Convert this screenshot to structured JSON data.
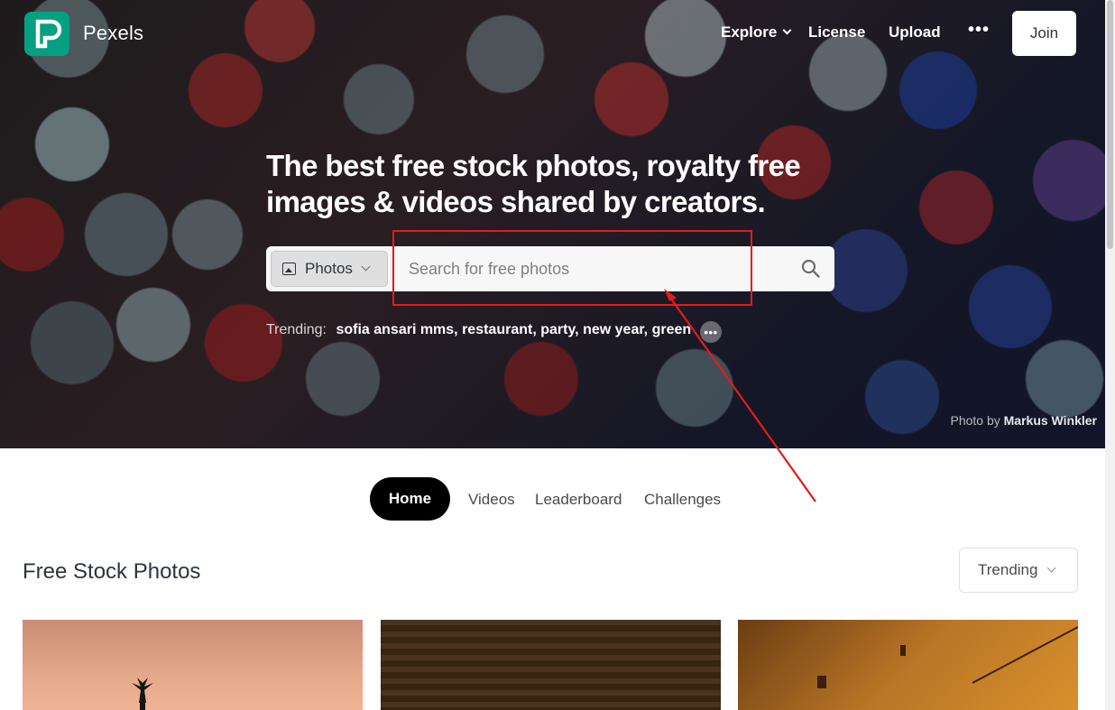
{
  "brand": {
    "name": "Pexels"
  },
  "nav": {
    "explore": "Explore",
    "license": "License",
    "upload": "Upload",
    "more": "•••",
    "join": "Join"
  },
  "hero": {
    "title": "The best free stock photos, royalty free images & videos shared by creators.",
    "credit_prefix": "Photo by",
    "credit_author": "Markus Winkler"
  },
  "search": {
    "type_label": "Photos",
    "placeholder": "Search for free photos",
    "value": ""
  },
  "trending": {
    "label": "Trending:",
    "items": [
      "sofia ansari mms,",
      "restaurant,",
      "party,",
      "new year,",
      "green"
    ],
    "more": "•••"
  },
  "tabs": {
    "home": "Home",
    "videos": "Videos",
    "leaderboard": "Leaderboard",
    "challenges": "Challenges"
  },
  "section": {
    "title": "Free Stock Photos",
    "sort": "Trending"
  },
  "colors": {
    "brand_green": "#05a081",
    "annotation_red": "#e51b1b",
    "text_dark": "#2c343e"
  }
}
